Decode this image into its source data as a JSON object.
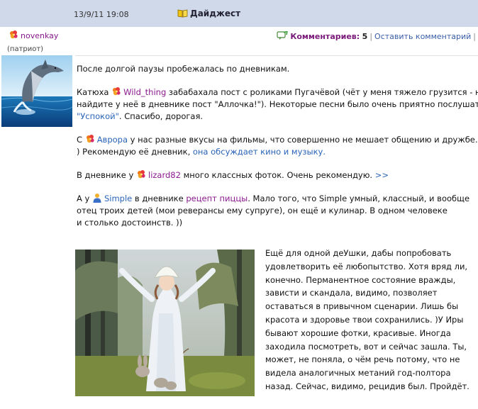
{
  "header": {
    "date": "13/9/11 19:08",
    "section": "Дайджест"
  },
  "author": {
    "name": "novenkay",
    "rank": "(патриот)"
  },
  "comments": {
    "label": "Комментариев:",
    "count": "5",
    "leave": "Оставить комментарий"
  },
  "post": {
    "p1": "После долгой паузы пробежалась по дневникам.",
    "p2": {
      "a": "Катюха ",
      "user": "Wild_thing",
      "b": " забабахала пост с роликами Пугачёвой (чёт у меня тяжело грузится - не",
      "c": "найдите у неё в дневнике пост \"Аллочка!\"). Некоторые песни было очень приятно послушать.",
      "link": "\"Успокой\"",
      "d": ". Спасибо, дорогая."
    },
    "p3": {
      "a": "С ",
      "user": "Аврора",
      "b": " у нас разные вкусы на фильмы, что совершенно не мешает общению и дружбе. Ш",
      "c": ") Рекомендую её дневник, ",
      "link": "она обсуждает кино и музыку."
    },
    "p4": {
      "a": "В дневнике у ",
      "user": "lizard82",
      "b": " много классных фоток. Очень рекомендую. ",
      "link": ">>"
    },
    "p5": {
      "a": "А у ",
      "user": "Simple",
      "b": " в дневнике ",
      "link": "рецепт пиццы",
      "c": ". Мало того, что Simple умный, классный, и вообще",
      "d": "отец троих детей (мои реверансы ему  супруге), он ещё и кулинар. В одном человеке",
      "e": "и столько достоинств. ))"
    },
    "side": "Ещё для одной деУшки, дабы попробовать удовлетворить её любопытство. Хотя вряд ли, конечно. Перманентное состояние вражды, зависти и скандала, видимо, позволяет оставаться в привычном сценарии. Лишь бы красота и здоровье твои сохранились. )У Иры бывают хорошие фотки, красивые. Иногда заходила посмотреть, вот и сейчас зашла. Ты, может, не поняла, о чём речь потому, что не видела аналогичных метаний год-полтора назад. Сейчас, видимо, рецидив был. Пройдёт."
  },
  "icons": {
    "digest": "book-icon",
    "user": "flower-icon",
    "simple_user": "user-icon",
    "comments": "comment-icon"
  },
  "colors": {
    "header_bg": "#cfd9e9",
    "username": "#8a1a8e",
    "link": "#2a64b8"
  }
}
